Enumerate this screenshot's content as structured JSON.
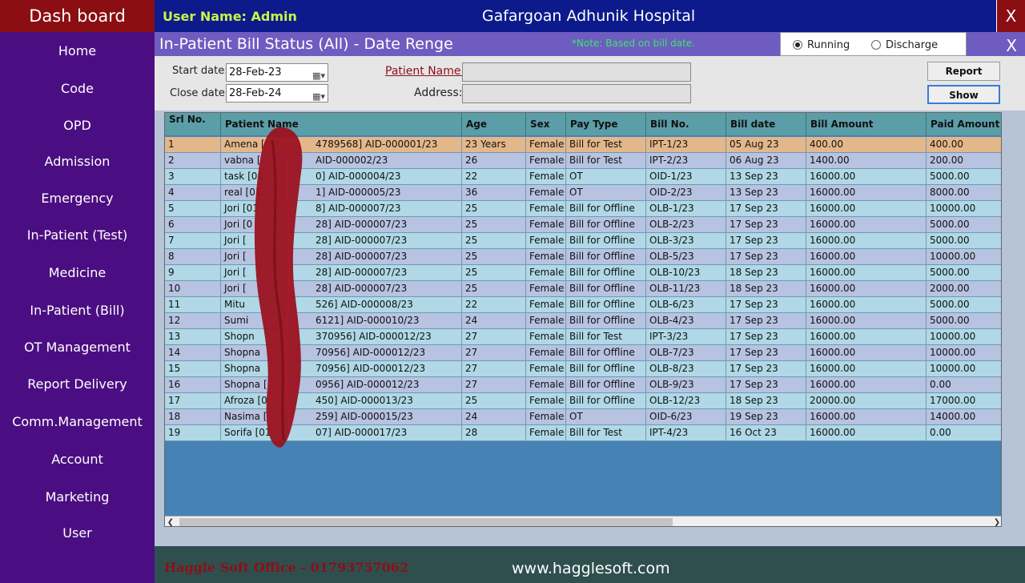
{
  "topbar": {
    "dashboard_title": "Dash board",
    "user_name": "User Name: Admin",
    "hospital_name": "Gafargoan Adhunik Hospital",
    "close_label": "X"
  },
  "sidebar": {
    "items": [
      {
        "label": "Home"
      },
      {
        "label": "Code"
      },
      {
        "label": "OPD"
      },
      {
        "label": "Admission"
      },
      {
        "label": "Emergency"
      },
      {
        "label": "In-Patient (Test)"
      },
      {
        "label": "Medicine"
      },
      {
        "label": "In-Patient (Bill)"
      },
      {
        "label": "OT Management"
      },
      {
        "label": "Report Delivery"
      },
      {
        "label": "Comm.Management"
      },
      {
        "label": "Account"
      },
      {
        "label": "Marketing"
      },
      {
        "label": "User"
      }
    ]
  },
  "subheader": {
    "title": "In-Patient Bill Status (All) - Date Renge",
    "note": "*Note: Based on bill date.",
    "radio_running": "Running",
    "radio_discharge": "Discharge",
    "selected": "Running",
    "close_label": "X"
  },
  "filters": {
    "start_label": "Start date:",
    "start_value": "28-Feb-23",
    "close_label": "Close date:",
    "close_value": "28-Feb-24",
    "patient_label": "Patient Name:",
    "patient_value": "",
    "address_label": "Address:",
    "address_value": "",
    "report_button": "Report",
    "show_button": "Show"
  },
  "grid": {
    "columns": [
      "Srl No.",
      "Patient Name",
      "Age",
      "Sex",
      "Pay Type",
      "Bill No.",
      "Bill date",
      "Bill Amount",
      "Paid Amount"
    ],
    "rows": [
      [
        "1",
        "Amena [",
        "4789568] AID-000001/23",
        "23 Years",
        "Female",
        "Bill for Test",
        "IPT-1/23",
        "05 Aug 23",
        "400.00",
        "400.00"
      ],
      [
        "2",
        "vabna [",
        "AID-000002/23",
        "26",
        "Female",
        "Bill for Test",
        "IPT-2/23",
        "06 Aug 23",
        "1400.00",
        "200.00"
      ],
      [
        "3",
        "task [01",
        "0] AID-000004/23",
        "22",
        "Female",
        "OT",
        "OID-1/23",
        "13 Sep 23",
        "16000.00",
        "5000.00"
      ],
      [
        "4",
        "real [01",
        "1] AID-000005/23",
        "36",
        "Female",
        "OT",
        "OID-2/23",
        "13 Sep 23",
        "16000.00",
        "8000.00"
      ],
      [
        "5",
        "Jori [01",
        "8] AID-000007/23",
        "25",
        "Female",
        "Bill for Offline",
        "OLB-1/23",
        "17 Sep 23",
        "16000.00",
        "10000.00"
      ],
      [
        "6",
        "Jori [0",
        "28] AID-000007/23",
        "25",
        "Female",
        "Bill for Offline",
        "OLB-2/23",
        "17 Sep 23",
        "16000.00",
        "5000.00"
      ],
      [
        "7",
        "Jori [",
        "28] AID-000007/23",
        "25",
        "Female",
        "Bill for Offline",
        "OLB-3/23",
        "17 Sep 23",
        "16000.00",
        "5000.00"
      ],
      [
        "8",
        "Jori [",
        "28] AID-000007/23",
        "25",
        "Female",
        "Bill for Offline",
        "OLB-5/23",
        "17 Sep 23",
        "16000.00",
        "10000.00"
      ],
      [
        "9",
        "Jori [",
        "28] AID-000007/23",
        "25",
        "Female",
        "Bill for Offline",
        "OLB-10/23",
        "18 Sep 23",
        "16000.00",
        "5000.00"
      ],
      [
        "10",
        "Jori [",
        "28] AID-000007/23",
        "25",
        "Female",
        "Bill for Offline",
        "OLB-11/23",
        "18 Sep 23",
        "16000.00",
        "2000.00"
      ],
      [
        "11",
        "Mitu",
        "526] AID-000008/23",
        "22",
        "Female",
        "Bill for Offline",
        "OLB-6/23",
        "17 Sep 23",
        "16000.00",
        "5000.00"
      ],
      [
        "12",
        "Sumi",
        "6121] AID-000010/23",
        "24",
        "Female",
        "Bill for Offline",
        "OLB-4/23",
        "17 Sep 23",
        "16000.00",
        "5000.00"
      ],
      [
        "13",
        "Shopn",
        "370956] AID-000012/23",
        "27",
        "Female",
        "Bill for Test",
        "IPT-3/23",
        "17 Sep 23",
        "16000.00",
        "10000.00"
      ],
      [
        "14",
        "Shopna",
        "70956] AID-000012/23",
        "27",
        "Female",
        "Bill for Offline",
        "OLB-7/23",
        "17 Sep 23",
        "16000.00",
        "10000.00"
      ],
      [
        "15",
        "Shopna",
        "70956] AID-000012/23",
        "27",
        "Female",
        "Bill for Offline",
        "OLB-8/23",
        "17 Sep 23",
        "16000.00",
        "10000.00"
      ],
      [
        "16",
        "Shopna [",
        "0956] AID-000012/23",
        "27",
        "Female",
        "Bill for Offline",
        "OLB-9/23",
        "17 Sep 23",
        "16000.00",
        "0.00"
      ],
      [
        "17",
        "Afroza [0",
        "450] AID-000013/23",
        "25",
        "Female",
        "Bill for Offline",
        "OLB-12/23",
        "18 Sep 23",
        "20000.00",
        "17000.00"
      ],
      [
        "18",
        "Nasima [",
        "259] AID-000015/23",
        "24",
        "Female",
        "OT",
        "OID-6/23",
        "19 Sep 23",
        "16000.00",
        "14000.00"
      ],
      [
        "19",
        "Sorifa [01",
        "07] AID-000017/23",
        "28",
        "Female",
        "Bill for Test",
        "IPT-4/23",
        "16 Oct 23",
        "16000.00",
        "0.00"
      ]
    ]
  },
  "footer": {
    "office": "Haggle Soft Office - 01793757062",
    "website": "www.hagglesoft.com"
  },
  "colors": {
    "topbar": "#0d1a8c",
    "dashboard": "#8b0e12",
    "sidebar": "#4b0e82",
    "subheader": "#6f5cc0",
    "header_row": "#5b9ea8",
    "row_even": "#b0d8e6",
    "row_odd": "#b7c3e0",
    "row_selected": "#e4b78a",
    "grid_empty": "#4682b4",
    "footer": "#2f4f4f"
  },
  "icons": {
    "calendar": "calendar-icon",
    "dropdown": "chevron-down-icon"
  }
}
